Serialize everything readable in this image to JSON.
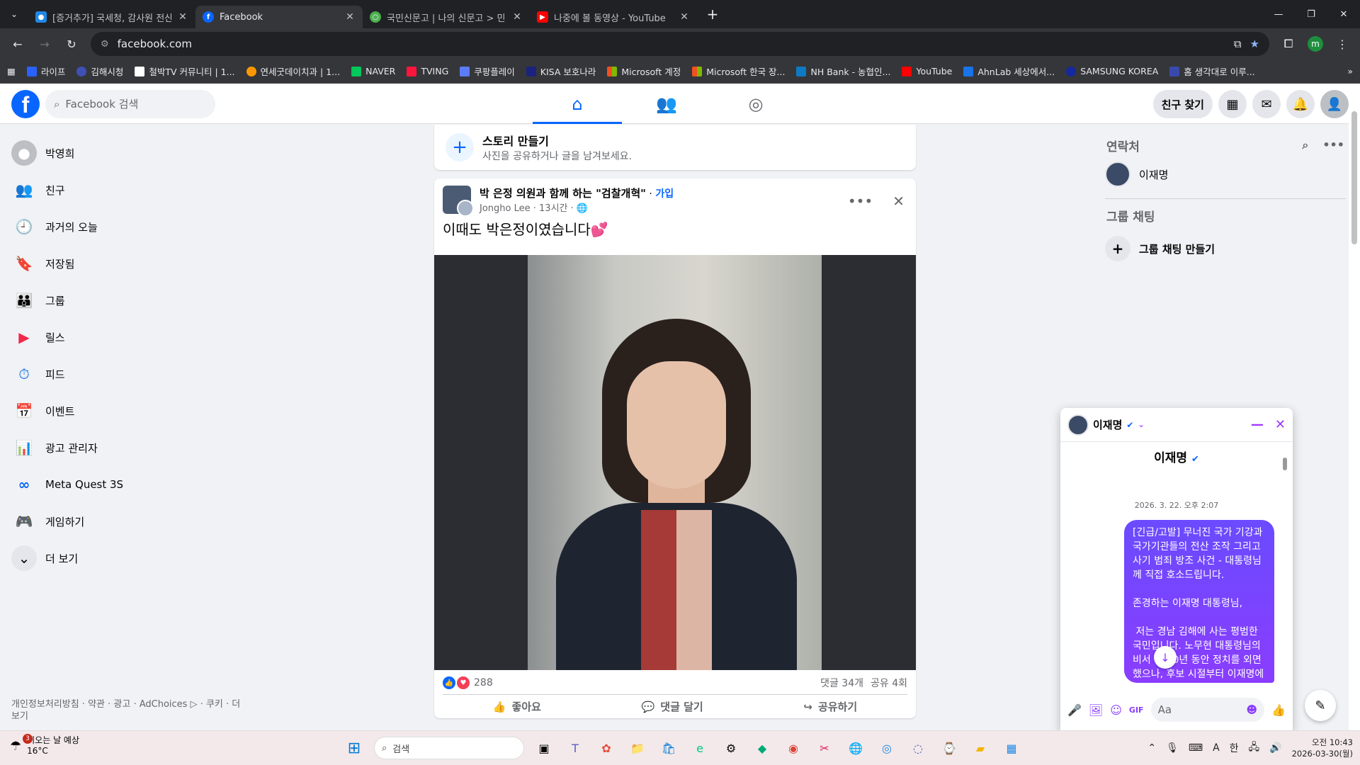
{
  "browser": {
    "tabs": [
      {
        "title": "[증거추가] 국세청, 감사원 전산",
        "favicon_color": "#1e88e5"
      },
      {
        "title": "Facebook",
        "favicon_color": "#0866ff"
      },
      {
        "title": "국민신문고 | 나의 신문고 > 민",
        "favicon_color": "#4caf50"
      },
      {
        "title": "나중에 볼 동영상 - YouTube",
        "favicon_color": "#ff0000"
      }
    ],
    "url": "facebook.com",
    "profile_initial": "m",
    "bookmarks": [
      "라이프",
      "김해시청",
      "철박TV 커뮤니티 | 1...",
      "연세굿데이치과 | 1...",
      "NAVER",
      "TVING",
      "쿠팡플레이",
      "KISA 보호나라",
      "Microsoft 계정",
      "Microsoft 한국 장...",
      "NH Bank - 농협인...",
      "YouTube",
      "AhnLab  세상에서...",
      "SAMSUNG KOREA",
      "홈  생각대로 이루..."
    ]
  },
  "header": {
    "search_placeholder": "Facebook 검색",
    "find_friends": "친구 찾기"
  },
  "leftnav": {
    "items": [
      {
        "label": "박영희",
        "icon": "profile-icon"
      },
      {
        "label": "친구",
        "icon": "friends-icon"
      },
      {
        "label": "과거의 오늘",
        "icon": "memories-icon"
      },
      {
        "label": "저장됨",
        "icon": "saved-icon"
      },
      {
        "label": "그룹",
        "icon": "groups-icon"
      },
      {
        "label": "릴스",
        "icon": "reels-icon"
      },
      {
        "label": "피드",
        "icon": "feeds-icon"
      },
      {
        "label": "이벤트",
        "icon": "events-icon"
      },
      {
        "label": "광고 관리자",
        "icon": "ads-manager-icon"
      },
      {
        "label": "Meta Quest 3S",
        "icon": "meta-icon"
      },
      {
        "label": "게임하기",
        "icon": "gaming-icon"
      },
      {
        "label": "더 보기",
        "icon": "chevron-down-icon"
      }
    ],
    "footer": "개인정보처리방침 · 약관 · 광고 · AdChoices ▷ · 쿠키 · 더 보기"
  },
  "story": {
    "title": "스토리 만들기",
    "subtitle": "사진을 공유하거나 글을 남겨보세요."
  },
  "post": {
    "group": "박 은정 의원과 함께 하는 \"검찰개혁\"",
    "join": "가입",
    "author": "Jongho Lee",
    "time": "13시간",
    "text": "이때도 박은정이였습니다💕",
    "reactions": "288",
    "comments": "댓글 34개",
    "shares": "공유 4회",
    "like_label": "좋아요",
    "comment_label": "댓글 달기",
    "share_label": "공유하기"
  },
  "contacts": {
    "title": "연락처",
    "items": [
      {
        "name": "이재명"
      }
    ],
    "group_title": "그룹 채팅",
    "create_group": "그룹 채팅 만들기"
  },
  "chat": {
    "name": "이재명",
    "date": "2026. 3. 22. 오후 2:07",
    "message": "[긴급/고발] 무너진 국가 기강과 국가기관들의 전산 조작 그리고 사기 범죄 방조 사건 - 대통령님께 직접 호소드립니다.\n\n존경하는 이재명 대통령님,\n\n 저는 경남 김해에 사는 평범한 국민입니다. 노무현 대통령님의 비서 후 20년 동안 정치를 외면했으나, 후보 시절부터 이재명에 감동하여 공정과",
    "input_placeholder": "Aa"
  },
  "taskbar": {
    "weather_title": "비오는 날 예상",
    "weather_temp": "16°C",
    "weather_badge": "3",
    "search_placeholder": "검색",
    "ime": "한",
    "lang": "A",
    "time": "오전 10:43",
    "date": "2026-03-30(월)"
  }
}
